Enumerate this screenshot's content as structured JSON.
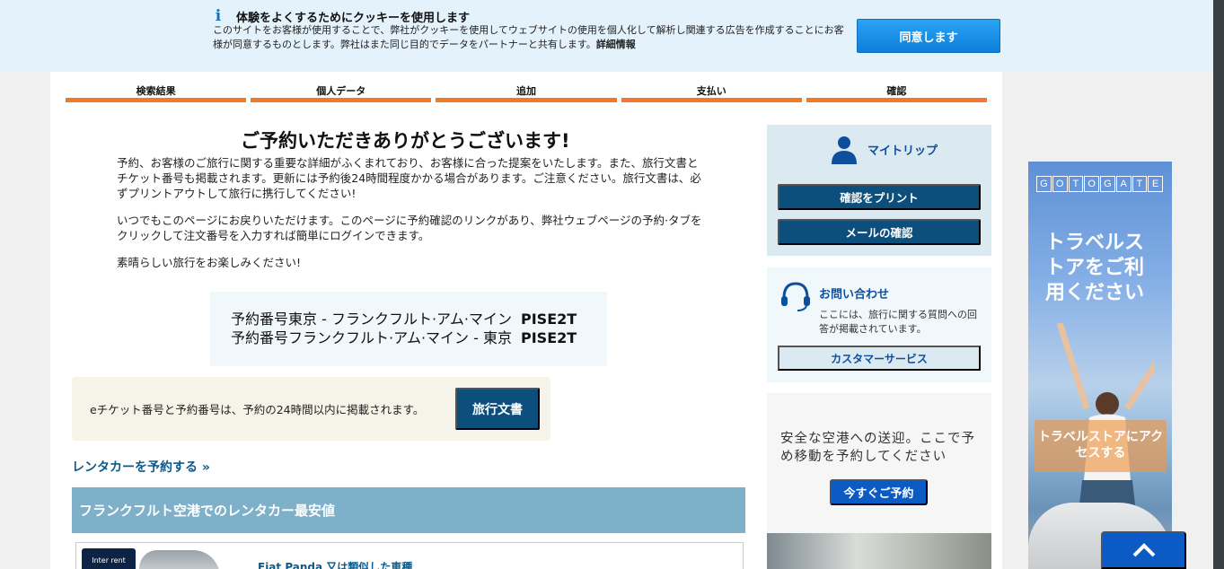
{
  "cookie": {
    "title": "体験をよくするためにクッキーを使用します",
    "text": "このサイトをお客様が使用することで、弊社がクッキーを使用してウェブサイトの使用を個人化して解析し関連する広告を作成することにお客様が同意するものとします。弊社はまた同じ目的でデータをパートナーと共有します。",
    "details_link": "詳細情報",
    "agree_label": "同意します"
  },
  "steps": [
    "検索結果",
    "個人データ",
    "追加",
    "支払い",
    "確認"
  ],
  "main": {
    "heading": "ご予約いただきありがとうございます!",
    "paragraph1": "予約、お客様のご旅行に関する重要な詳細がふくまれており、お客様に合った提案をいたします。また、旅行文書とチケット番号も掲載されます。更新には予約後24時間程度かかる場合があります。ご注意ください。旅行文書は、必ずプリントアウトして旅行に携行してください!",
    "paragraph2": "いつでもこのページにお戻りいただけます。このページに予約確認のリンクがあり、弊社ウェブページの予約·タブをクリックして注文番号を入力すれば簡単にログインできます。",
    "paragraph3": "素晴らしい旅行をお楽しみください!",
    "bookings": [
      {
        "label": "予約番号東京 - フランクフルト·アム·マイン",
        "code": "PISE2T"
      },
      {
        "label": "予約番号フランクフルト·アム·マイン - 東京",
        "code": "PISE2T"
      }
    ],
    "eticket_text": "eチケット番号と予約番号は、予約の24時間以内に掲載されます。",
    "travel_docs_label": "旅行文書",
    "rental_link": "レンタカーを予約する »",
    "car_header": "フランクフルト空港でのレンタカー最安値",
    "car_logo": "Inter rent",
    "car_name": "Fiat Panda 又は類似した車種"
  },
  "sidebar": {
    "mytrip_title": "マイトリップ",
    "print_label": "確認をプリント",
    "email_label": "メールの確認",
    "contact_title": "お問い合わせ",
    "contact_text": "ここには、旅行に関する質問への回答が掲載されています。",
    "customer_service_label": "カスタマーサービス",
    "transfer_text": "安全な空港への送迎。ここで予め移動を予約してください",
    "book_now_label": "今すぐご予約"
  },
  "ad": {
    "brand_letters": [
      "G",
      "O",
      "T",
      "O",
      "G",
      "A",
      "T",
      "E"
    ],
    "title": "トラベルストアをご利用ください",
    "button_label": "トラベルストアにアクセスする"
  },
  "colors": {
    "accent_orange": "#f07a2a",
    "primary_dark_blue": "#0d4f7c",
    "link_blue": "#0d5a8c",
    "cookie_bg": "#e4f2fb"
  }
}
